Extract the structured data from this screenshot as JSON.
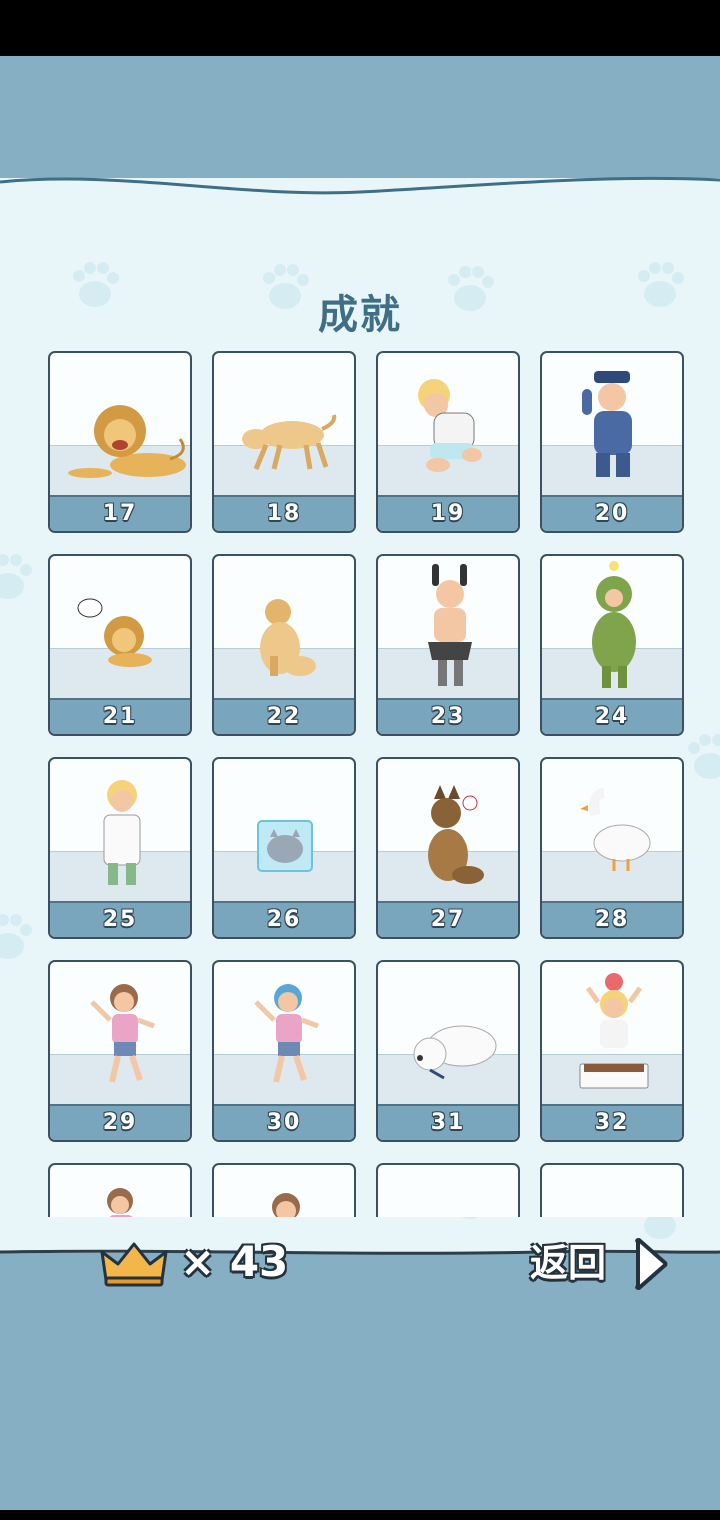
{
  "title": "成就",
  "cards": [
    {
      "number": "17",
      "art": "lion"
    },
    {
      "number": "18",
      "art": "dog-sniff"
    },
    {
      "number": "19",
      "art": "boy-crying"
    },
    {
      "number": "20",
      "art": "police"
    },
    {
      "number": "21",
      "art": "lion-small"
    },
    {
      "number": "22",
      "art": "dog-sit"
    },
    {
      "number": "23",
      "art": "bunny-costume"
    },
    {
      "number": "24",
      "art": "green-costume"
    },
    {
      "number": "25",
      "art": "doctor"
    },
    {
      "number": "26",
      "art": "cat-ice"
    },
    {
      "number": "27",
      "art": "shepherd"
    },
    {
      "number": "28",
      "art": "goose"
    },
    {
      "number": "29",
      "art": "girl-dance"
    },
    {
      "number": "30",
      "art": "girl-dance-blue"
    },
    {
      "number": "31",
      "art": "polar-bear"
    },
    {
      "number": "32",
      "art": "boy-tub"
    },
    {
      "number": "",
      "art": "girl-partial"
    },
    {
      "number": "",
      "art": "girl-partial-2"
    },
    {
      "number": "",
      "art": "empty"
    },
    {
      "number": "",
      "art": "empty"
    }
  ],
  "crown_count": "× 43",
  "back_label": "返回",
  "colors": {
    "accent": "#86afc4",
    "panel": "#e9f6f9",
    "bar": "#7aa6bd",
    "title": "#3f6f86",
    "crown": "#f2b64a"
  }
}
